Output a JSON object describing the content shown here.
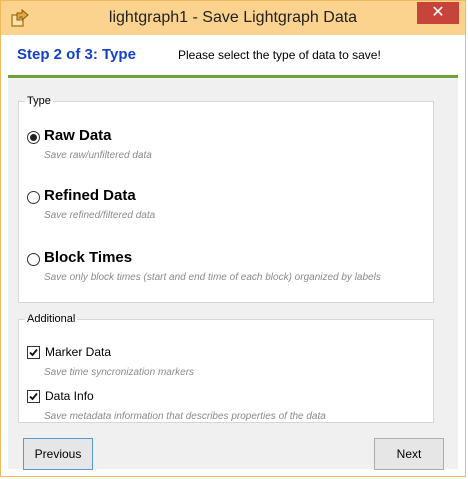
{
  "window": {
    "title": "lightgraph1 - Save Lightgraph Data",
    "close_glyph": "✕",
    "app_icon": "export-icon"
  },
  "header": {
    "step_title": "Step 2 of 3: Type",
    "step_desc": "Please select the type of data to save!",
    "accent": "#6aa138",
    "step_color": "#1540c9"
  },
  "type_group": {
    "legend": "Type",
    "options": [
      {
        "label": "Raw Data",
        "desc": "Save raw/unfiltered data",
        "selected": true
      },
      {
        "label": "Refined Data",
        "desc": "Save refined/filtered data",
        "selected": false
      },
      {
        "label": "Block Times",
        "desc": "Save only block times (start and end time of each block) organized by labels",
        "selected": false
      }
    ]
  },
  "additional_group": {
    "legend": "Additional",
    "options": [
      {
        "label": "Marker Data",
        "desc": "Save time syncronization markers",
        "checked": true
      },
      {
        "label": "Data Info",
        "desc": "Save metadata information that describes properties of the data",
        "checked": true
      }
    ]
  },
  "buttons": {
    "previous": "Previous",
    "next": "Next"
  }
}
